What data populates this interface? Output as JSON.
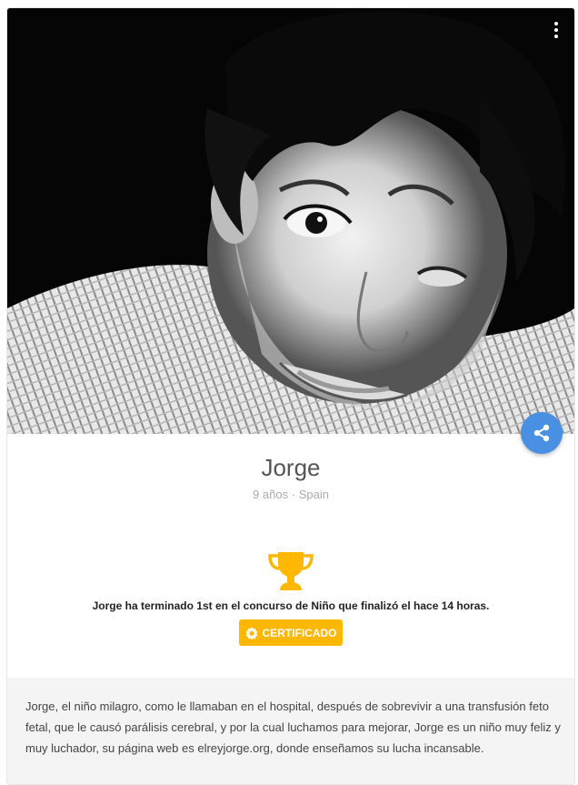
{
  "profile": {
    "name": "Jorge",
    "age": "9 años",
    "separator": "·",
    "country": "Spain"
  },
  "achievement": {
    "text": "Jorge ha terminado 1st en el concurso de Niño que finalizó el hace 14 horas.",
    "button_label": "CERTIFICADO",
    "icon": "trophy-icon",
    "color": "#ffb700"
  },
  "description": "Jorge, el niño milagro, como le llamaban en el hospital, después de sobrevivir a una transfusión feto fetal, que le causó parálisis cerebral, y por la cual luchamos para mejorar, Jorge es un niño muy feliz y muy luchador, su página web es elreyjorge.org, donde enseñamos su lucha incansable.",
  "icons": {
    "menu": "more-vertical-icon",
    "share": "share-icon",
    "badge": "badge-icon"
  },
  "colors": {
    "share_button": "#4a90e2",
    "description_bg": "#f4f4f4"
  }
}
